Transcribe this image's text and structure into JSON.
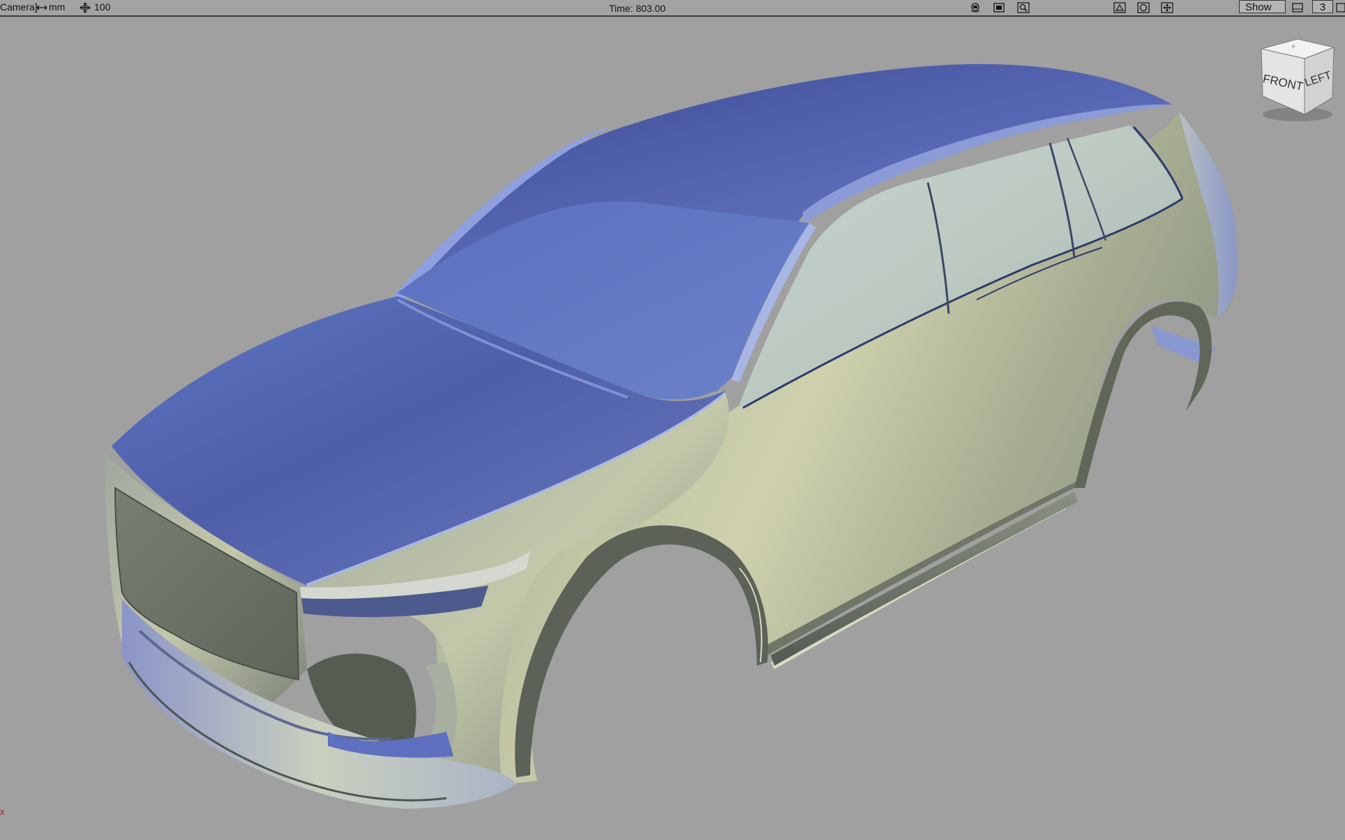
{
  "toolbar": {
    "view_label": "Camera]",
    "unit_label": "mm",
    "grid_value": "100",
    "time_label": "Time: 803.00",
    "show_label": "Show",
    "layer_number": "3",
    "left_icons": [
      "units-arrow-icon",
      "grid-move-icon"
    ],
    "center_icons": [
      "camera-tumble-icon",
      "camera-dolly-icon",
      "camera-zoom-icon"
    ],
    "right_icons": [
      "view-fit-icon",
      "view-frame-icon",
      "view-pan-icon"
    ]
  },
  "viewcube": {
    "front_label": "FRONT",
    "left_label": "LEFT"
  },
  "colors": {
    "viewport_background": "#a0a0a0",
    "body_blue": "#5a6fc0",
    "body_pale": "#c8cdb0",
    "body_dark": "#5c6258",
    "axis_red": "#c01515"
  }
}
